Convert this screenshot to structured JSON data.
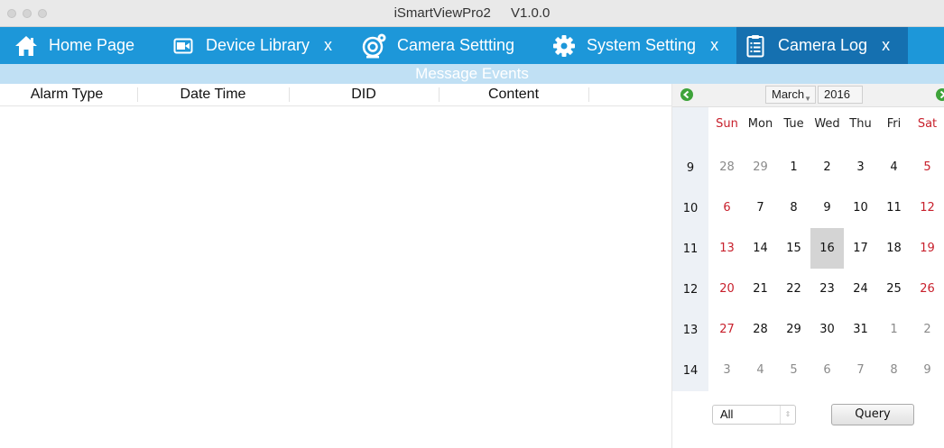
{
  "window": {
    "title": "iSmartViewPro2",
    "version": "V1.0.0"
  },
  "tabs": [
    {
      "label": "Home Page",
      "icon": "home-icon",
      "closable": false,
      "active": false
    },
    {
      "label": "Device Library",
      "icon": "video-folder-icon",
      "closable": true,
      "close_label": "x",
      "active": false
    },
    {
      "label": "Camera Settting",
      "icon": "webcam-settings-icon",
      "closable": false,
      "active": false
    },
    {
      "label": "System Setting",
      "icon": "gear-icon",
      "closable": true,
      "close_label": "x",
      "active": false
    },
    {
      "label": "Camera Log",
      "icon": "clipboard-icon",
      "closable": true,
      "close_label": "x",
      "active": true
    }
  ],
  "banner": {
    "title": "Message Events"
  },
  "table": {
    "columns": [
      "Alarm Type",
      "Date Time",
      "DID",
      "Content"
    ],
    "rows": []
  },
  "calendar": {
    "month": "March",
    "year": "2016",
    "weekday_headers": [
      "Sun",
      "Mon",
      "Tue",
      "Wed",
      "Thu",
      "Fri",
      "Sat"
    ],
    "week_numbers": [
      "9",
      "10",
      "11",
      "12",
      "13",
      "14"
    ],
    "days": [
      [
        "28",
        "29",
        "1",
        "2",
        "3",
        "4",
        "5"
      ],
      [
        "6",
        "7",
        "8",
        "9",
        "10",
        "11",
        "12"
      ],
      [
        "13",
        "14",
        "15",
        "16",
        "17",
        "18",
        "19"
      ],
      [
        "20",
        "21",
        "22",
        "23",
        "24",
        "25",
        "26"
      ],
      [
        "27",
        "28",
        "29",
        "30",
        "31",
        "1",
        "2"
      ],
      [
        "3",
        "4",
        "5",
        "6",
        "7",
        "8",
        "9"
      ]
    ],
    "selected_day": "16",
    "weekend_color": "#c8202c"
  },
  "filter": {
    "selected": "All"
  },
  "query_button": {
    "label": "Query"
  },
  "colors": {
    "tabbar": "#1d97d9",
    "active_tab": "#1570b0",
    "banner": "#c0e0f4"
  }
}
